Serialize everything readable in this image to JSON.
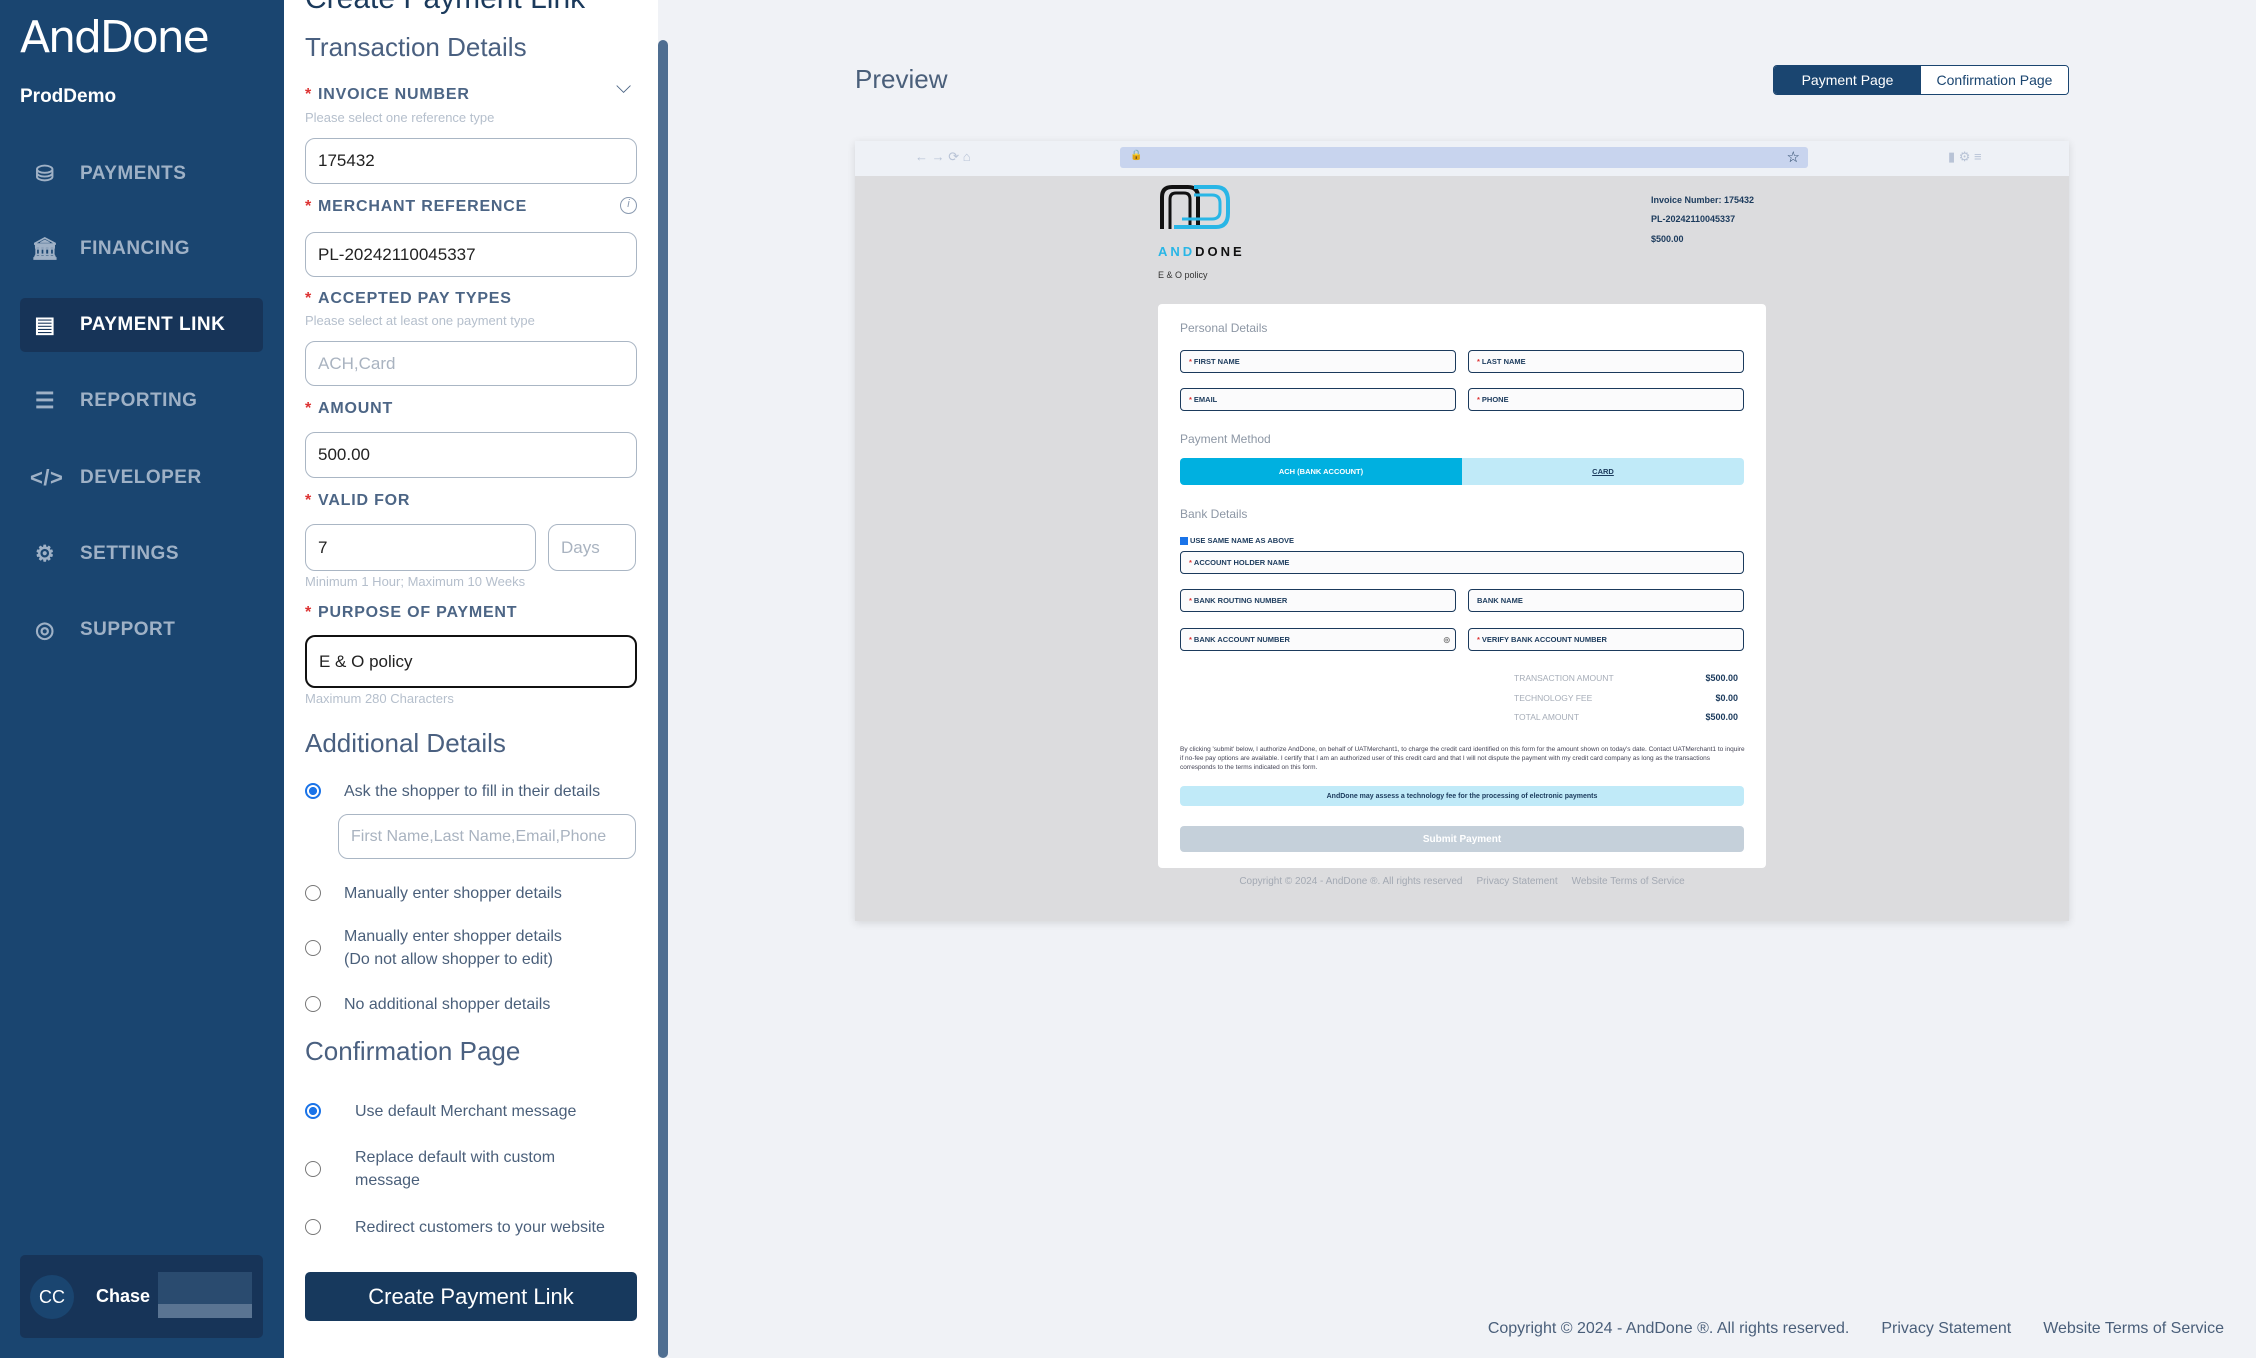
{
  "sidebar": {
    "brand": "AndDone",
    "org": "ProdDemo",
    "items": [
      {
        "label": "PAYMENTS",
        "icon": "payments-icon"
      },
      {
        "label": "FINANCING",
        "icon": "bank-icon"
      },
      {
        "label": "PAYMENT LINK",
        "icon": "payment-link-icon",
        "active": true
      },
      {
        "label": "REPORTING",
        "icon": "report-icon"
      },
      {
        "label": "DEVELOPER",
        "icon": "code-icon"
      },
      {
        "label": "SETTINGS",
        "icon": "gear-icon"
      },
      {
        "label": "SUPPORT",
        "icon": "globe-icon"
      }
    ],
    "user": {
      "initials": "CC",
      "name": "Chase"
    }
  },
  "form": {
    "title": "Create Payment Link",
    "transaction_heading": "Transaction Details",
    "invoice": {
      "label": "INVOICE NUMBER",
      "hint": "Please select one reference type",
      "value": "175432"
    },
    "merchant_ref": {
      "label": "MERCHANT REFERENCE",
      "value": "PL-20242110045337"
    },
    "pay_types": {
      "label": "ACCEPTED PAY TYPES",
      "hint": "Please select at least one payment type",
      "value": "ACH,Card"
    },
    "amount": {
      "label": "AMOUNT",
      "value": "500.00"
    },
    "valid_for": {
      "label": "VALID FOR",
      "value": "7",
      "unit": "Days",
      "hint": "Minimum 1 Hour; Maximum 10 Weeks"
    },
    "purpose": {
      "label": "PURPOSE OF PAYMENT",
      "value": "E & O policy",
      "hint": "Maximum 280 Characters"
    },
    "additional_heading": "Additional Details",
    "additional_options": [
      "Ask the shopper to fill in their details",
      "Manually enter shopper details",
      "Manually enter shopper details\n(Do not allow shopper to edit)",
      "No additional shopper details"
    ],
    "shopper_fields": "First Name,Last Name,Email,Phone",
    "confirmation_heading": "Confirmation Page",
    "confirmation_options": [
      "Use default Merchant message",
      "Replace default with custom message",
      "Redirect customers to your website"
    ],
    "submit": "Create Payment Link"
  },
  "preview": {
    "title": "Preview",
    "tabs": [
      "Payment Page",
      "Confirmation Page"
    ],
    "logo_text": "ANDDONE",
    "purpose": "E & O policy",
    "invoice_line": "Invoice Number: 175432",
    "ref": "PL-20242110045337",
    "amount": "$500.00",
    "personal_heading": "Personal Details",
    "first": "FIRST NAME",
    "last": "LAST NAME",
    "email": "EMAIL",
    "phone": "PHONE",
    "method_heading": "Payment Method",
    "ach": "ACH (BANK ACCOUNT)",
    "card": "CARD",
    "bank_heading": "Bank Details",
    "same_name": "USE SAME NAME AS ABOVE",
    "holder": "ACCOUNT HOLDER NAME",
    "routing": "BANK ROUTING NUMBER",
    "bank_name": "BANK NAME",
    "account": "BANK ACCOUNT NUMBER",
    "verify": "VERIFY BANK ACCOUNT NUMBER",
    "summary": [
      {
        "label": "TRANSACTION AMOUNT",
        "value": "$500.00"
      },
      {
        "label": "TECHNOLOGY FEE",
        "value": "$0.00"
      },
      {
        "label": "TOTAL AMOUNT",
        "value": "$500.00"
      }
    ],
    "legal": "By clicking 'submit' below, I authorize AndDone, on behalf of UATMerchant1, to charge the credit card identified on this form for the amount shown on today's date. Contact UATMerchant1 to inquire if no-fee pay options are available. I certify that I am an authorized user of this credit card and that I will not dispute the payment with my credit card company as long as the transactions corresponds to the terms indicated on this form.",
    "fee_note": "AndDone may assess a technology fee for the processing of electronic payments",
    "submit": "Submit Payment",
    "footer": [
      "Copyright © 2024 - AndDone ®. All rights reserved",
      "Privacy Statement",
      "Website Terms of Service"
    ]
  },
  "footer": {
    "copyright": "Copyright © 2024 - AndDone ®. All rights reserved.",
    "privacy": "Privacy Statement",
    "terms": "Website Terms of Service"
  },
  "colors": {
    "sidebar": "#1a4570",
    "accent": "#00b0e0",
    "button": "#17395d"
  }
}
